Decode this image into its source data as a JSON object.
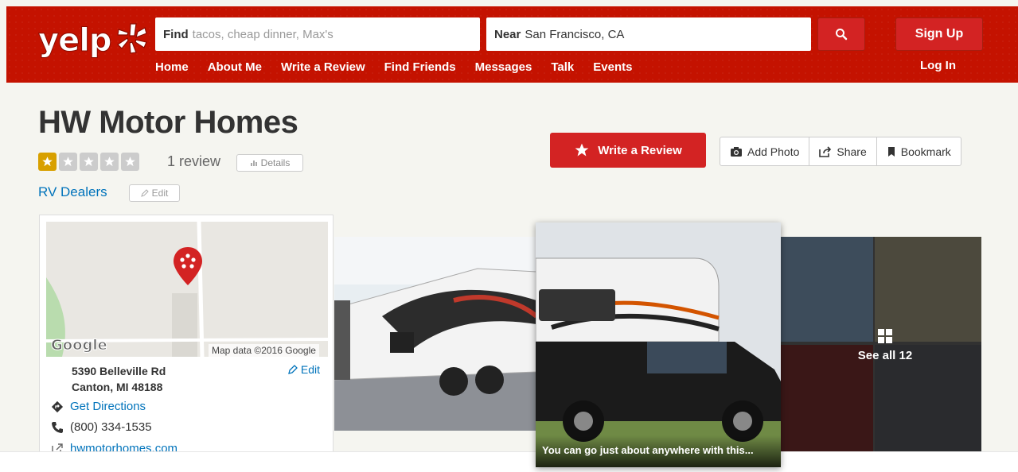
{
  "header": {
    "logo": "yelp",
    "search": {
      "find_label": "Find",
      "find_placeholder": "tacos, cheap dinner, Max's",
      "near_label": "Near",
      "near_value": "San Francisco, CA"
    },
    "signup_label": "Sign Up",
    "login_label": "Log In",
    "nav": [
      "Home",
      "About Me",
      "Write a Review",
      "Find Friends",
      "Messages",
      "Talk",
      "Events"
    ],
    "brand_color": "#d32323"
  },
  "business": {
    "name": "HW Motor Homes",
    "rating": 1,
    "rating_max": 5,
    "review_count": "1 review",
    "details_label": "Details",
    "category": "RV Dealers",
    "edit_label": "Edit"
  },
  "actions": {
    "write_review": "Write a Review",
    "add_photo": "Add Photo",
    "share": "Share",
    "bookmark": "Bookmark"
  },
  "map_card": {
    "map_credit": "Map data ©2016 Google",
    "map_logo": "Google",
    "address_line1": "5390 Belleville Rd",
    "address_line2": "Canton, MI 48188",
    "edit_label": "Edit",
    "directions": "Get Directions",
    "phone": "(800) 334-1535",
    "website": "hwmotorhomes.com"
  },
  "photos": {
    "caption": "You can go just about anywhere with this...",
    "see_all": "See all 12"
  }
}
